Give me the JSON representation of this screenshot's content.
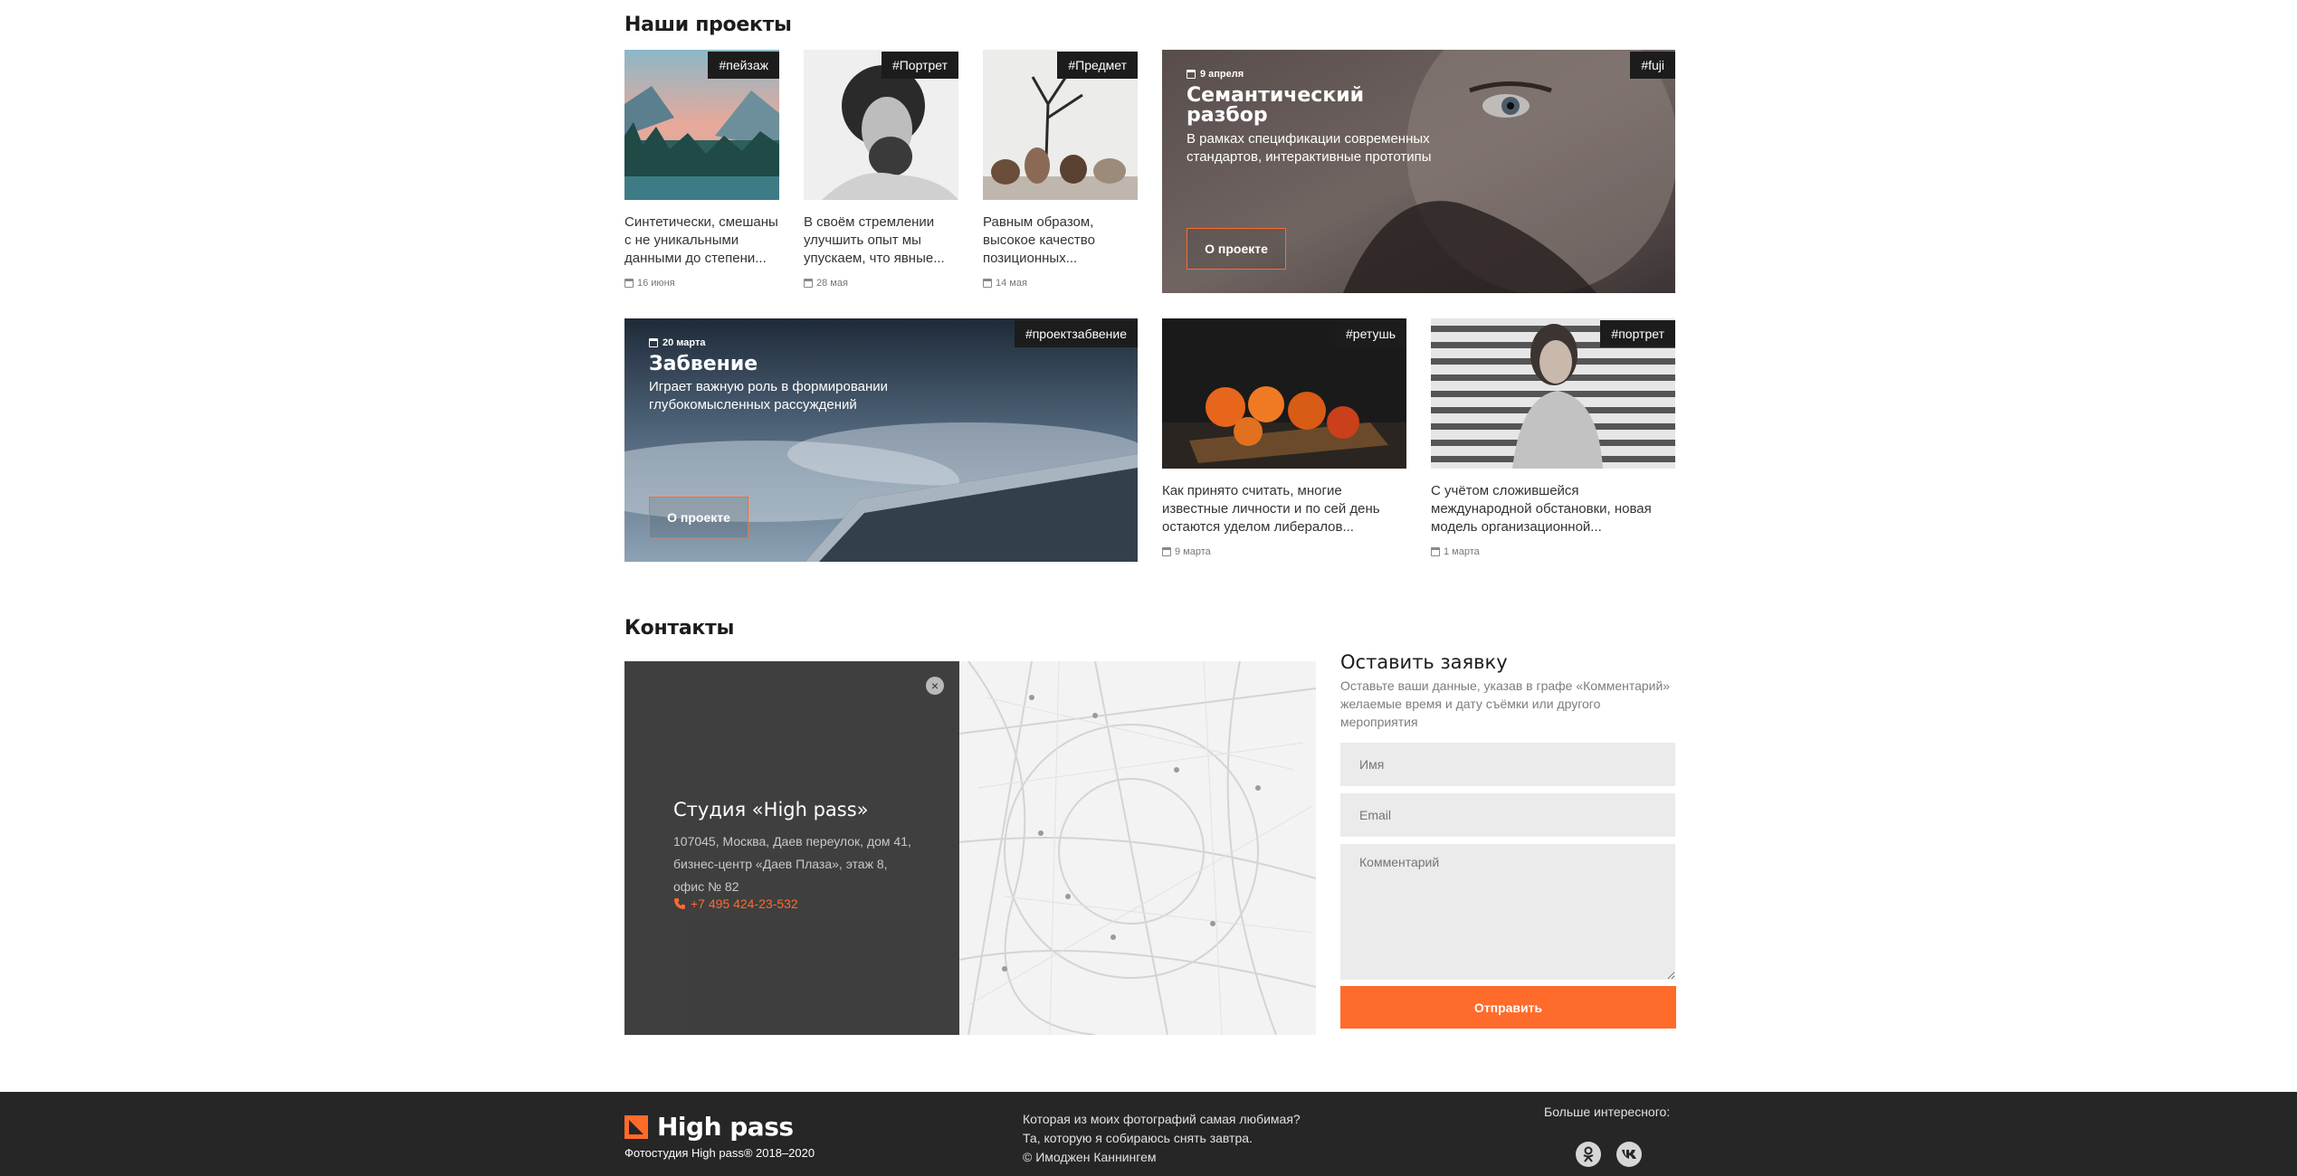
{
  "projects": {
    "title": "Наши проекты",
    "small": [
      {
        "tag": "#пейзаж",
        "text": "Синтетически, смешаны с не уникальными данными до степени...",
        "date": "16 июня"
      },
      {
        "tag": "#Портрет",
        "text": "В своём стремлении улучшить опыт мы упускаем, что явные...",
        "date": "28 мая"
      },
      {
        "tag": "#Предмет",
        "text": "Равным образом, высокое качество позиционных...",
        "date": "14 мая"
      },
      {
        "tag": "#ретушь",
        "text": "Как принято считать, многие известные личности и по сей день остаются уделом либералов...",
        "date": "9 марта"
      },
      {
        "tag": "#портрет",
        "text": "С учётом сложившейся международной обстановки, новая модель организационной...",
        "date": "1 марта"
      }
    ],
    "featured": [
      {
        "tag": "#fuji",
        "date": "9 апреля",
        "title_line1": "Семантический",
        "title_line2": "разбор",
        "text": "В рамках спецификации современных стандартов, интерактивные прототипы",
        "button": "О проекте"
      },
      {
        "tag": "#проектзабвение",
        "date": "20 марта",
        "title": "Забвение",
        "text": "Играет важную роль в формировании глубокомысленных рассуждений",
        "button": "О проекте"
      }
    ]
  },
  "contacts": {
    "title": "Контакты",
    "studio": "Студия «High pass»",
    "address": "107045, Москва, Даев переулок, дом 41, бизнес-центр «Даев Плаза», этаж 8, офис № 82",
    "phone": "+7 495 424-23-532",
    "close": "×"
  },
  "form": {
    "title": "Оставить заявку",
    "subtitle": "Оставьте ваши данные, указав в графе «Комментарий» желаемые время и дату съёмки или другого мероприятия",
    "name_placeholder": "Имя",
    "email_placeholder": "Email",
    "comment_placeholder": "Комментарий",
    "submit": "Отправить"
  },
  "footer": {
    "brand": "High pass",
    "copyright": "Фотостудия High pass® 2018–2020",
    "quote_line1": "Которая из моих фотографий самая любимая?",
    "quote_line2": "Та, которую я собираюсь снять завтра.",
    "quote_line3": "© Имоджен Каннингем",
    "more": "Больше интересного:",
    "social": [
      "odnoklassniki-icon",
      "vk-icon"
    ]
  },
  "colors": {
    "accent": "#ff6b2b",
    "dark": "#262626"
  }
}
